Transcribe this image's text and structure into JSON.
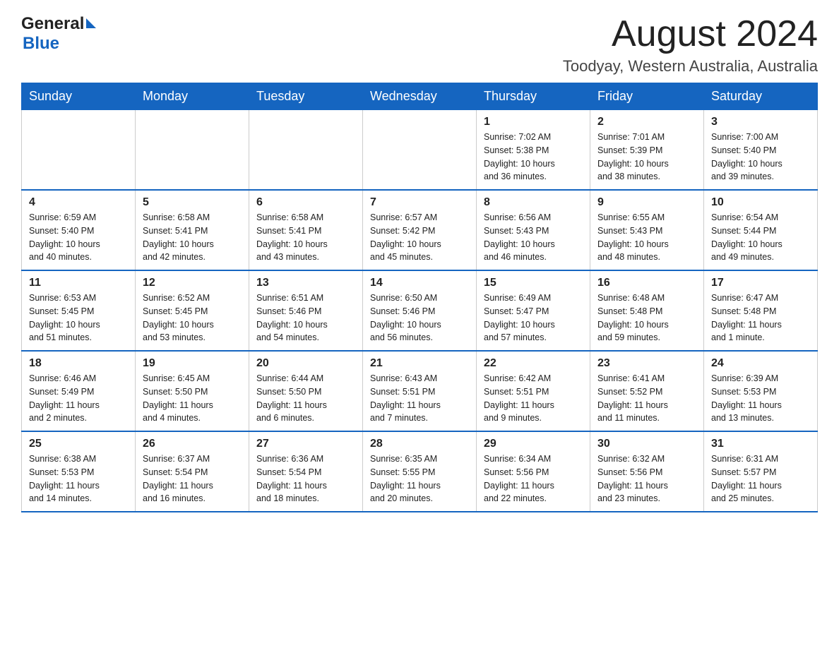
{
  "header": {
    "logo_general": "General",
    "logo_blue": "Blue",
    "month_title": "August 2024",
    "location": "Toodyay, Western Australia, Australia"
  },
  "weekdays": [
    "Sunday",
    "Monday",
    "Tuesday",
    "Wednesday",
    "Thursday",
    "Friday",
    "Saturday"
  ],
  "weeks": [
    [
      {
        "day": "",
        "info": ""
      },
      {
        "day": "",
        "info": ""
      },
      {
        "day": "",
        "info": ""
      },
      {
        "day": "",
        "info": ""
      },
      {
        "day": "1",
        "info": "Sunrise: 7:02 AM\nSunset: 5:38 PM\nDaylight: 10 hours\nand 36 minutes."
      },
      {
        "day": "2",
        "info": "Sunrise: 7:01 AM\nSunset: 5:39 PM\nDaylight: 10 hours\nand 38 minutes."
      },
      {
        "day": "3",
        "info": "Sunrise: 7:00 AM\nSunset: 5:40 PM\nDaylight: 10 hours\nand 39 minutes."
      }
    ],
    [
      {
        "day": "4",
        "info": "Sunrise: 6:59 AM\nSunset: 5:40 PM\nDaylight: 10 hours\nand 40 minutes."
      },
      {
        "day": "5",
        "info": "Sunrise: 6:58 AM\nSunset: 5:41 PM\nDaylight: 10 hours\nand 42 minutes."
      },
      {
        "day": "6",
        "info": "Sunrise: 6:58 AM\nSunset: 5:41 PM\nDaylight: 10 hours\nand 43 minutes."
      },
      {
        "day": "7",
        "info": "Sunrise: 6:57 AM\nSunset: 5:42 PM\nDaylight: 10 hours\nand 45 minutes."
      },
      {
        "day": "8",
        "info": "Sunrise: 6:56 AM\nSunset: 5:43 PM\nDaylight: 10 hours\nand 46 minutes."
      },
      {
        "day": "9",
        "info": "Sunrise: 6:55 AM\nSunset: 5:43 PM\nDaylight: 10 hours\nand 48 minutes."
      },
      {
        "day": "10",
        "info": "Sunrise: 6:54 AM\nSunset: 5:44 PM\nDaylight: 10 hours\nand 49 minutes."
      }
    ],
    [
      {
        "day": "11",
        "info": "Sunrise: 6:53 AM\nSunset: 5:45 PM\nDaylight: 10 hours\nand 51 minutes."
      },
      {
        "day": "12",
        "info": "Sunrise: 6:52 AM\nSunset: 5:45 PM\nDaylight: 10 hours\nand 53 minutes."
      },
      {
        "day": "13",
        "info": "Sunrise: 6:51 AM\nSunset: 5:46 PM\nDaylight: 10 hours\nand 54 minutes."
      },
      {
        "day": "14",
        "info": "Sunrise: 6:50 AM\nSunset: 5:46 PM\nDaylight: 10 hours\nand 56 minutes."
      },
      {
        "day": "15",
        "info": "Sunrise: 6:49 AM\nSunset: 5:47 PM\nDaylight: 10 hours\nand 57 minutes."
      },
      {
        "day": "16",
        "info": "Sunrise: 6:48 AM\nSunset: 5:48 PM\nDaylight: 10 hours\nand 59 minutes."
      },
      {
        "day": "17",
        "info": "Sunrise: 6:47 AM\nSunset: 5:48 PM\nDaylight: 11 hours\nand 1 minute."
      }
    ],
    [
      {
        "day": "18",
        "info": "Sunrise: 6:46 AM\nSunset: 5:49 PM\nDaylight: 11 hours\nand 2 minutes."
      },
      {
        "day": "19",
        "info": "Sunrise: 6:45 AM\nSunset: 5:50 PM\nDaylight: 11 hours\nand 4 minutes."
      },
      {
        "day": "20",
        "info": "Sunrise: 6:44 AM\nSunset: 5:50 PM\nDaylight: 11 hours\nand 6 minutes."
      },
      {
        "day": "21",
        "info": "Sunrise: 6:43 AM\nSunset: 5:51 PM\nDaylight: 11 hours\nand 7 minutes."
      },
      {
        "day": "22",
        "info": "Sunrise: 6:42 AM\nSunset: 5:51 PM\nDaylight: 11 hours\nand 9 minutes."
      },
      {
        "day": "23",
        "info": "Sunrise: 6:41 AM\nSunset: 5:52 PM\nDaylight: 11 hours\nand 11 minutes."
      },
      {
        "day": "24",
        "info": "Sunrise: 6:39 AM\nSunset: 5:53 PM\nDaylight: 11 hours\nand 13 minutes."
      }
    ],
    [
      {
        "day": "25",
        "info": "Sunrise: 6:38 AM\nSunset: 5:53 PM\nDaylight: 11 hours\nand 14 minutes."
      },
      {
        "day": "26",
        "info": "Sunrise: 6:37 AM\nSunset: 5:54 PM\nDaylight: 11 hours\nand 16 minutes."
      },
      {
        "day": "27",
        "info": "Sunrise: 6:36 AM\nSunset: 5:54 PM\nDaylight: 11 hours\nand 18 minutes."
      },
      {
        "day": "28",
        "info": "Sunrise: 6:35 AM\nSunset: 5:55 PM\nDaylight: 11 hours\nand 20 minutes."
      },
      {
        "day": "29",
        "info": "Sunrise: 6:34 AM\nSunset: 5:56 PM\nDaylight: 11 hours\nand 22 minutes."
      },
      {
        "day": "30",
        "info": "Sunrise: 6:32 AM\nSunset: 5:56 PM\nDaylight: 11 hours\nand 23 minutes."
      },
      {
        "day": "31",
        "info": "Sunrise: 6:31 AM\nSunset: 5:57 PM\nDaylight: 11 hours\nand 25 minutes."
      }
    ]
  ]
}
